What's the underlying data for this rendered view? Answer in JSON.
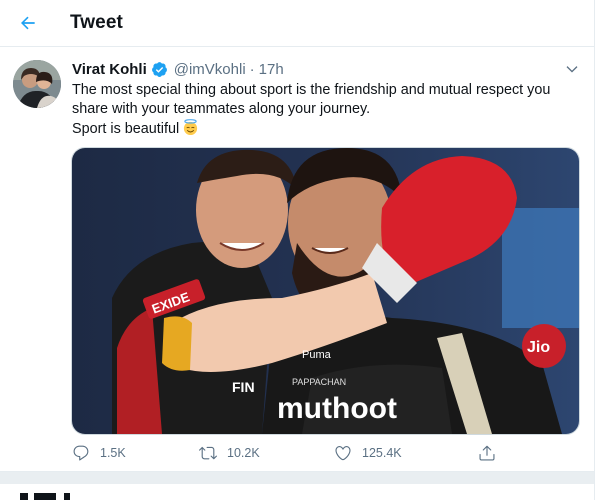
{
  "header": {
    "title": "Tweet"
  },
  "tweet": {
    "display_name": "Virat Kohli",
    "handle": "@imVkohli",
    "separator": "·",
    "time": "17h",
    "text_line_1": "The most special thing about sport is the friendship and mutual respect you",
    "text_line_2": "share with your teammates along your journey.",
    "text_line_3": "Sport is beautiful",
    "media": {
      "jersey_brand": "muthoot",
      "jersey_sub": "PAPPACHAN",
      "sleeve_text": "EXIDE",
      "chest_text": "Jio",
      "side_text": "FIN",
      "maker": "Puma"
    },
    "stats": {
      "replies": "1.5K",
      "retweets": "10.2K",
      "likes": "125.4K"
    }
  },
  "colors": {
    "accent": "#1da1f2",
    "secondary_text": "#5b7083",
    "divider": "#e6ecf0"
  }
}
